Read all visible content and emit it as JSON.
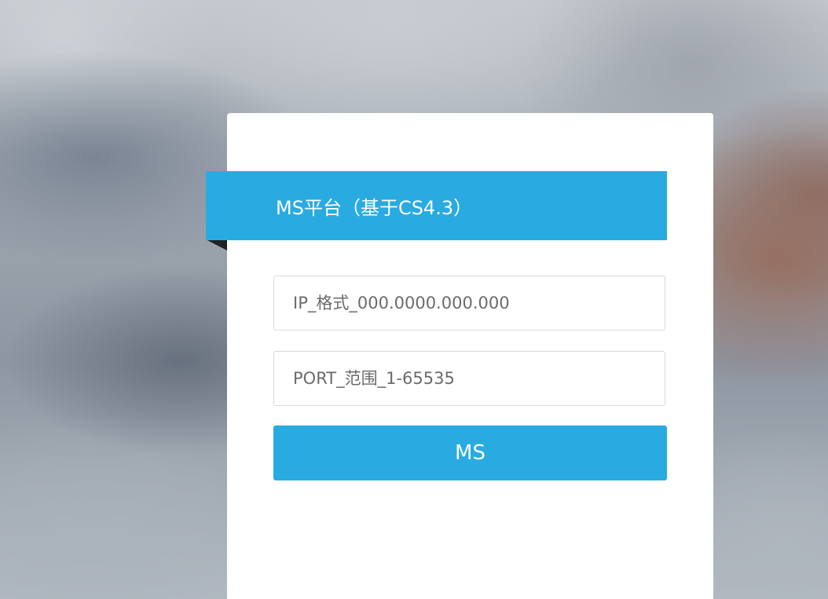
{
  "header": {
    "title": "MS平台（基于CS4.3）"
  },
  "form": {
    "ip_input": {
      "value": "",
      "placeholder": "IP_格式_000.0000.000.000"
    },
    "port_input": {
      "value": "",
      "placeholder": "PORT_范围_1-65535"
    },
    "submit_label": "MS"
  },
  "colors": {
    "accent": "#29abe2",
    "card_background": "#ffffff",
    "fold_shadow": "#222222",
    "input_border": "#d9d9d9"
  }
}
